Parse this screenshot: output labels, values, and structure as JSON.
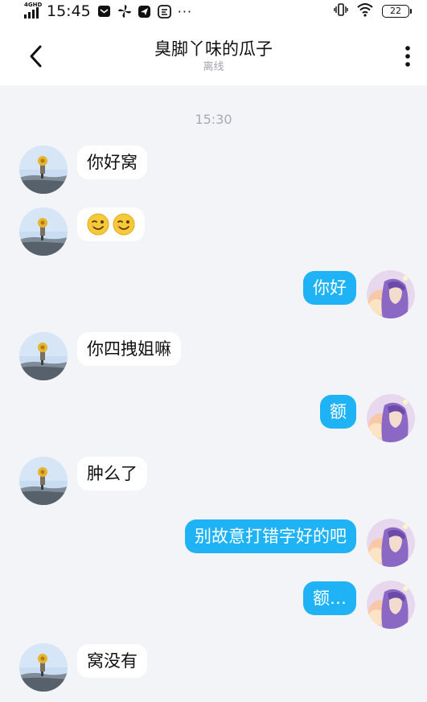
{
  "status_bar": {
    "network": "4G",
    "network_sub": "HD",
    "time": "15:45",
    "overflow": "···",
    "battery": "22",
    "icons": [
      "message-icon",
      "pinwheel-icon",
      "send-icon",
      "app-icon",
      "vibrate-icon",
      "wifi-icon",
      "battery-icon"
    ]
  },
  "header": {
    "title": "臭脚丫味的瓜子",
    "subtitle": "离线",
    "back_icon": "chevron-left-icon",
    "more_icon": "more-vertical-icon"
  },
  "chat": {
    "timestamp": "15:30",
    "messages": [
      {
        "side": "in",
        "text": "你好窝"
      },
      {
        "side": "in",
        "text": "",
        "emojis": [
          "wink-emoji",
          "wink-emoji"
        ]
      },
      {
        "side": "out",
        "text": "你好"
      },
      {
        "side": "in",
        "text": "你四拽姐嘛"
      },
      {
        "side": "out",
        "text": "额"
      },
      {
        "side": "in",
        "text": "肿么了"
      },
      {
        "side": "out",
        "text": "别故意打错字好的吧"
      },
      {
        "side": "out",
        "text": "额…"
      },
      {
        "side": "in",
        "text": "窝没有"
      }
    ]
  },
  "colors": {
    "outgoing_bubble": "#1fb3f5",
    "incoming_bubble": "#ffffff",
    "background": "#f3f4f8"
  }
}
